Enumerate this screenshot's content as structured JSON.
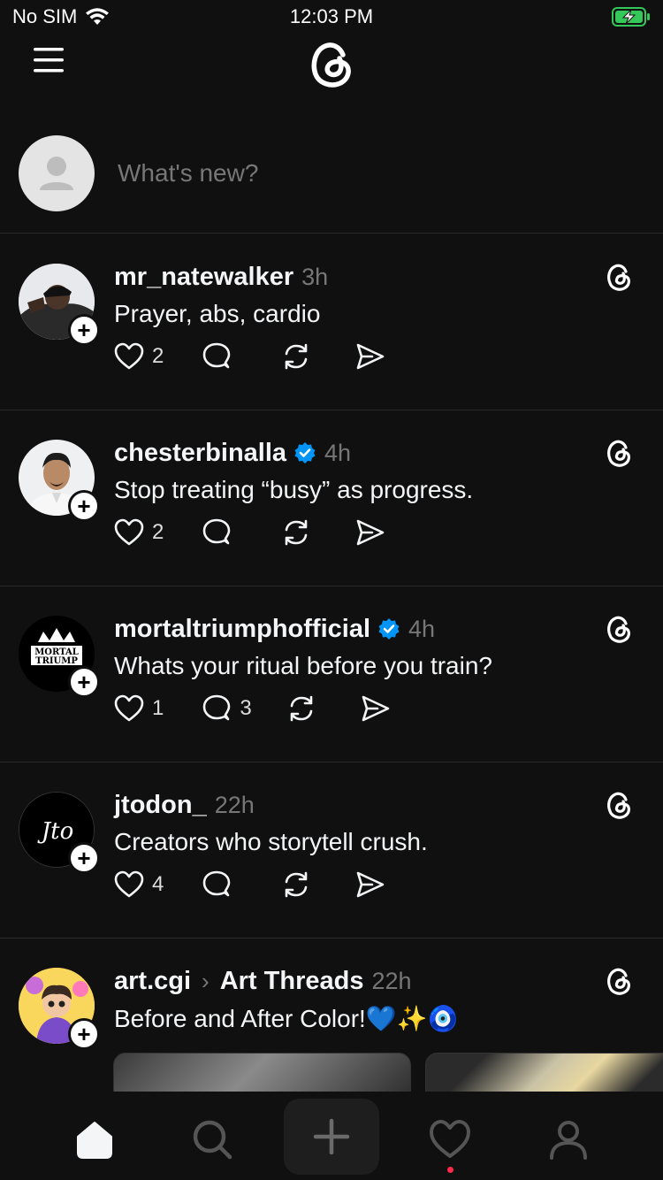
{
  "status_bar": {
    "carrier": "No SIM",
    "time": "12:03 PM"
  },
  "composer": {
    "placeholder": "What's new?"
  },
  "posts": [
    {
      "username": "mr_natewalker",
      "verified": false,
      "time": "3h",
      "text": "Prayer, abs, cardio",
      "likes": "2",
      "replies": "",
      "avatar_desc": "man-in-cap"
    },
    {
      "username": "chesterbinalla",
      "verified": true,
      "time": "4h",
      "text": "Stop treating “busy” as progress.",
      "likes": "2",
      "replies": "",
      "avatar_desc": "man-portrait"
    },
    {
      "username": "mortaltriumphofficial",
      "verified": true,
      "time": "4h",
      "text": "Whats your ritual before you train?",
      "likes": "1",
      "replies": "3",
      "avatar_desc": "mortal-triumph-logo"
    },
    {
      "username": "jtodon_",
      "verified": false,
      "time": "22h",
      "text": "Creators who storytell crush.",
      "likes": "4",
      "replies": "",
      "avatar_desc": "jto-monogram"
    },
    {
      "username": "art.cgi",
      "topic": "Art Threads",
      "verified": false,
      "time": "22h",
      "text": "Before and After Color!💙✨🧿",
      "likes": "",
      "replies": "",
      "avatar_desc": "cartoon-character"
    }
  ],
  "avatar_logos": {
    "mortal": "MORTAL TRIUMP",
    "jto": "Jto"
  },
  "tab_bar": {
    "active": "home",
    "has_notification": true
  },
  "colors": {
    "background": "#101010",
    "text": "#f3f5f7",
    "muted": "#777777",
    "verified": "#0095f6",
    "battery": "#34c759",
    "notification_dot": "#ff2b4a"
  }
}
